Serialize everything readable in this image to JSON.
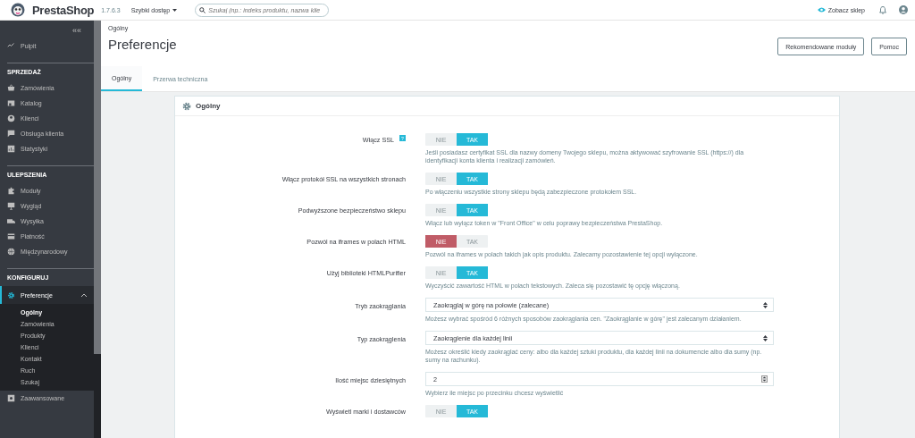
{
  "header": {
    "logo": "PrestaShop",
    "version": "1.7.6.3",
    "quick_access": "Szybki dostęp",
    "search": {
      "placeholder": "Szukaj (np.: indeks produktu, nazwa klie"
    },
    "view_shop": "Zobacz sklep"
  },
  "sidebar": {
    "collapse": "«",
    "top_items": [
      {
        "label": "Pulpit",
        "selected": false
      }
    ],
    "sections": [
      {
        "title": "SPRZEDAŻ",
        "items": [
          {
            "label": "Zamówienia",
            "selected": false
          },
          {
            "label": "Katalog",
            "selected": false
          },
          {
            "label": "Klienci",
            "selected": false
          },
          {
            "label": "Obsługa klienta",
            "selected": false
          },
          {
            "label": "Statystyki",
            "selected": false
          }
        ]
      },
      {
        "title": "ULEPSZENIA",
        "items": [
          {
            "label": "Moduły",
            "selected": false
          },
          {
            "label": "Wygląd",
            "selected": false
          },
          {
            "label": "Wysyłka",
            "selected": false
          },
          {
            "label": "Płatność",
            "selected": false
          },
          {
            "label": "Międzynarodowy",
            "selected": false
          }
        ]
      },
      {
        "title": "KONFIGURUJ",
        "items": [
          {
            "label": "Preferencje",
            "selected": true,
            "expanded": true,
            "children": [
              {
                "label": "Ogólny",
                "selected": true
              },
              {
                "label": "Zamówienia",
                "selected": false
              },
              {
                "label": "Produkty",
                "selected": false
              },
              {
                "label": "Klienci",
                "selected": false
              },
              {
                "label": "Kontakt",
                "selected": false
              },
              {
                "label": "Ruch",
                "selected": false
              },
              {
                "label": "Szukaj",
                "selected": false
              }
            ]
          },
          {
            "label": "Zaawansowane",
            "selected": false
          }
        ]
      }
    ]
  },
  "toolbar": {
    "breadcrumb": "Ogólny",
    "title": "Preferencje",
    "buttons": [
      "Rekomendowane moduły",
      "Pomoc"
    ]
  },
  "tabs": [
    {
      "label": "Ogólny",
      "selected": true
    },
    {
      "label": "Przerwa techniczna",
      "selected": false
    }
  ],
  "panel": {
    "title": "Ogólny",
    "fields": [
      {
        "kind": "switch",
        "label": "Włącz SSL",
        "help_icon": "?",
        "off": "NIE",
        "on": "TAK",
        "value": true,
        "help": "Jeśli posiadasz certyfikat SSL dla nazwy domeny Twojego sklepu, można aktywować szyfrowanie SSL (https://) dla identyfikacji konta klienta i realizacji zamówień."
      },
      {
        "kind": "switch",
        "label": "Włącz protokół SSL na wszystkich stronach",
        "off": "NIE",
        "on": "TAK",
        "value": true,
        "help": "Po włączeniu wszystkie strony sklepu będą zabezpieczone protokołem SSL."
      },
      {
        "kind": "switch",
        "label": "Podwyższone bezpieczeństwo sklepu",
        "off": "NIE",
        "on": "TAK",
        "value": true,
        "help": "Włącz lub wyłącz token w \"Front Office\" w celu poprawy bezpieczeństwa PrestaShop."
      },
      {
        "kind": "switch",
        "label": "Pozwól na iframes w polach HTML",
        "off": "NIE",
        "on": "TAK",
        "value": false,
        "help": "Pozwól na iframes w polach takich jak opis produktu. Zalecamy pozostawienie tej opcji wyłączone."
      },
      {
        "kind": "switch",
        "label": "Użyj biblioteki HTMLPurifier",
        "off": "NIE",
        "on": "TAK",
        "value": true,
        "help": "Wyczyścić zawartość HTML w polach tekstowych. Zaleca się pozostawić tę opcję włączoną."
      },
      {
        "kind": "select",
        "label": "Tryb zaokrąglania",
        "value": "Zaokrąglaj w górę na połowie (zalecane)",
        "help": "Możesz wybrać spośród 6 różnych sposobów zaokrąglania cen. \"Zaokrąglanie w górę\" jest zalecanym działaniem."
      },
      {
        "kind": "select",
        "label": "Typ zaokrąglenia",
        "value": "Zaokrąglenie dla każdej linii",
        "help": "Możesz określić kiedy zaokrąglać ceny: albo dla każdej sztuki produktu, dla każdej linii na dokumencie albo dla sumy (np. sumy na rachunku)."
      },
      {
        "kind": "number",
        "label": "Ilość miejsc dziesiętnych",
        "value": "2",
        "help": "Wybierz ile miejsc po przecinku chcesz wyświetlić"
      },
      {
        "kind": "switch",
        "label": "Wyświetl marki i dostawców",
        "off": "NIE",
        "on": "TAK",
        "value": true
      }
    ]
  }
}
